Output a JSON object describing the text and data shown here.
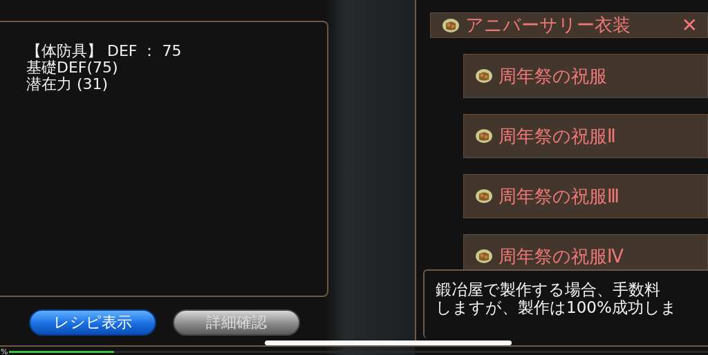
{
  "equipment_stats": {
    "lines": [
      "【体防具】 DEF ： 75",
      "基礎DEF(75)",
      "潜在力 (31)"
    ]
  },
  "buttons": [
    {
      "label": "レシピ表示",
      "kind": "primary"
    },
    {
      "label": "詳細確認",
      "kind": "secondary"
    }
  ],
  "recipe_tree": {
    "label": "アニバーサリー衣装",
    "close": "✕",
    "children": [
      {
        "label": "周年祭の祝服"
      },
      {
        "label": "周年祭の祝服Ⅱ"
      },
      {
        "label": "周年祭の祝服Ⅲ"
      },
      {
        "label": "周年祭の祝服Ⅳ"
      }
    ]
  },
  "description": [
    "鍛冶屋で製作する場合、手数料",
    "しますが、製作は100%成功しま"
  ],
  "loading": {
    "reading": "%",
    "level": 0.15
  }
}
